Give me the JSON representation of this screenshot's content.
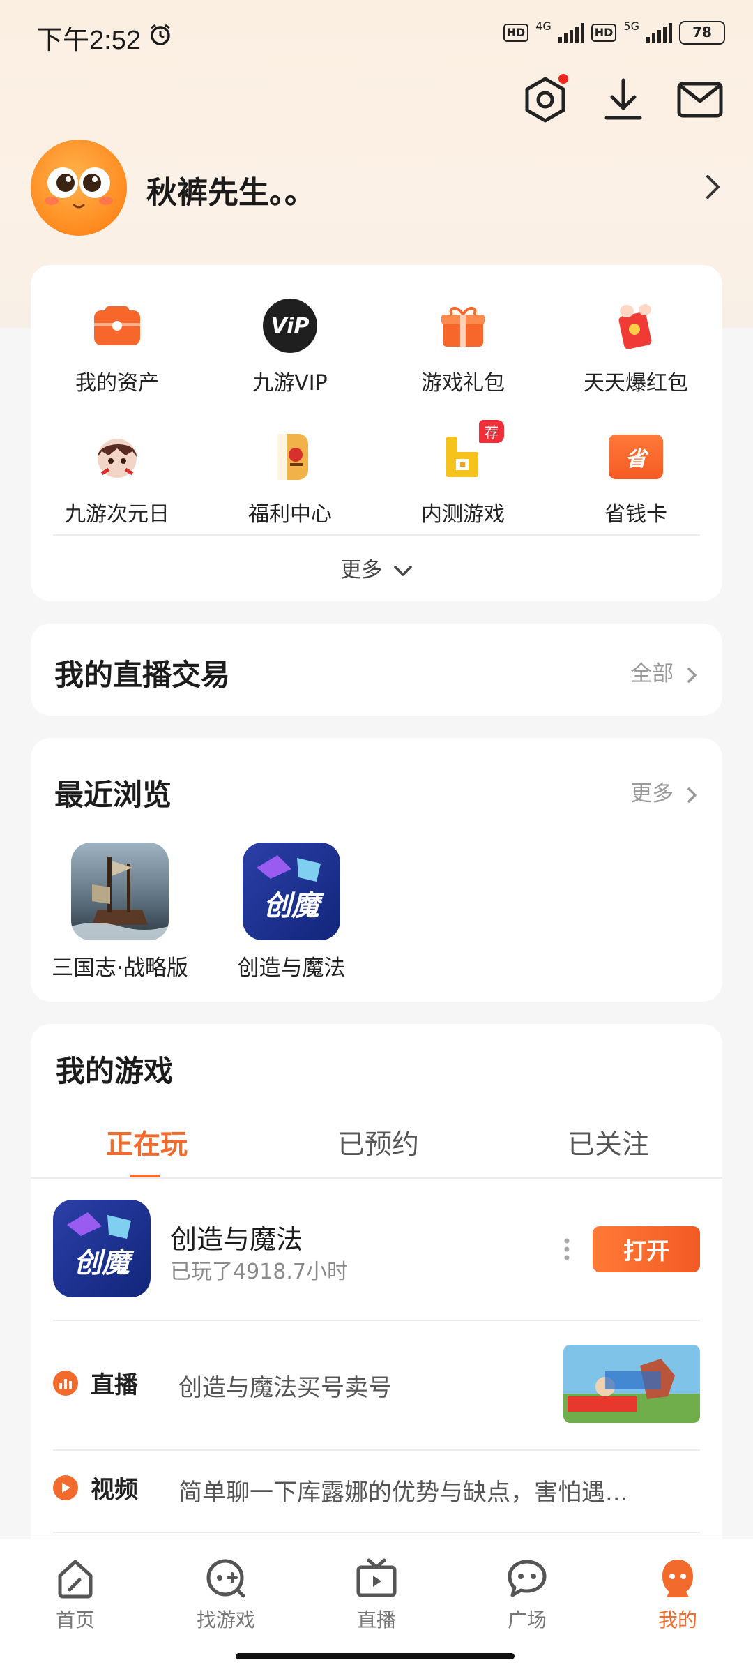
{
  "status": {
    "time": "下午2:52",
    "net1": "4G",
    "net2": "5G",
    "battery": "78",
    "hd": "HD"
  },
  "header": {
    "settings_icon": "settings-icon",
    "download_icon": "download-icon",
    "mail_icon": "mail-icon"
  },
  "profile": {
    "name": "秋裤先生。。"
  },
  "quick": {
    "items": [
      {
        "label": "我的资产",
        "icon": "wallet-icon"
      },
      {
        "label": "九游VIP",
        "icon": "vip-icon",
        "icon_text": "ViP"
      },
      {
        "label": "游戏礼包",
        "icon": "gift-icon"
      },
      {
        "label": "天天爆红包",
        "icon": "red-packet-icon"
      },
      {
        "label": "九游次元日",
        "icon": "anime-icon"
      },
      {
        "label": "福利中心",
        "icon": "welfare-icon"
      },
      {
        "label": "内测游戏",
        "icon": "beta-icon",
        "badge": "荐"
      },
      {
        "label": "省钱卡",
        "icon": "save-card-icon",
        "icon_text": "省"
      }
    ],
    "more": "更多"
  },
  "live_trade": {
    "title": "我的直播交易",
    "link": "全部"
  },
  "recent": {
    "title": "最近浏览",
    "link": "更多",
    "items": [
      {
        "label": "三国志·战略版"
      },
      {
        "label": "创造与魔法"
      }
    ]
  },
  "my_games": {
    "title": "我的游戏",
    "tabs": [
      "正在玩",
      "已预约",
      "已关注"
    ],
    "game": {
      "name": "创造与魔法",
      "playtime": "已玩了4918.7小时",
      "button": "打开",
      "icon_text": "创魔"
    },
    "feed": [
      {
        "tag": "直播",
        "text": "创造与魔法买号卖号"
      },
      {
        "tag": "视频",
        "text": "简单聊一下库露娜的优势与缺点，害怕遇..."
      }
    ]
  },
  "nav": {
    "items": [
      {
        "label": "首页",
        "icon": "home-icon"
      },
      {
        "label": "找游戏",
        "icon": "game-controller-icon"
      },
      {
        "label": "直播",
        "icon": "live-tv-icon"
      },
      {
        "label": "广场",
        "icon": "chat-bubble-icon"
      },
      {
        "label": "我的",
        "icon": "profile-icon"
      }
    ]
  },
  "colors": {
    "accent": "#f26a2c",
    "header_bg": "#fbefe2"
  }
}
